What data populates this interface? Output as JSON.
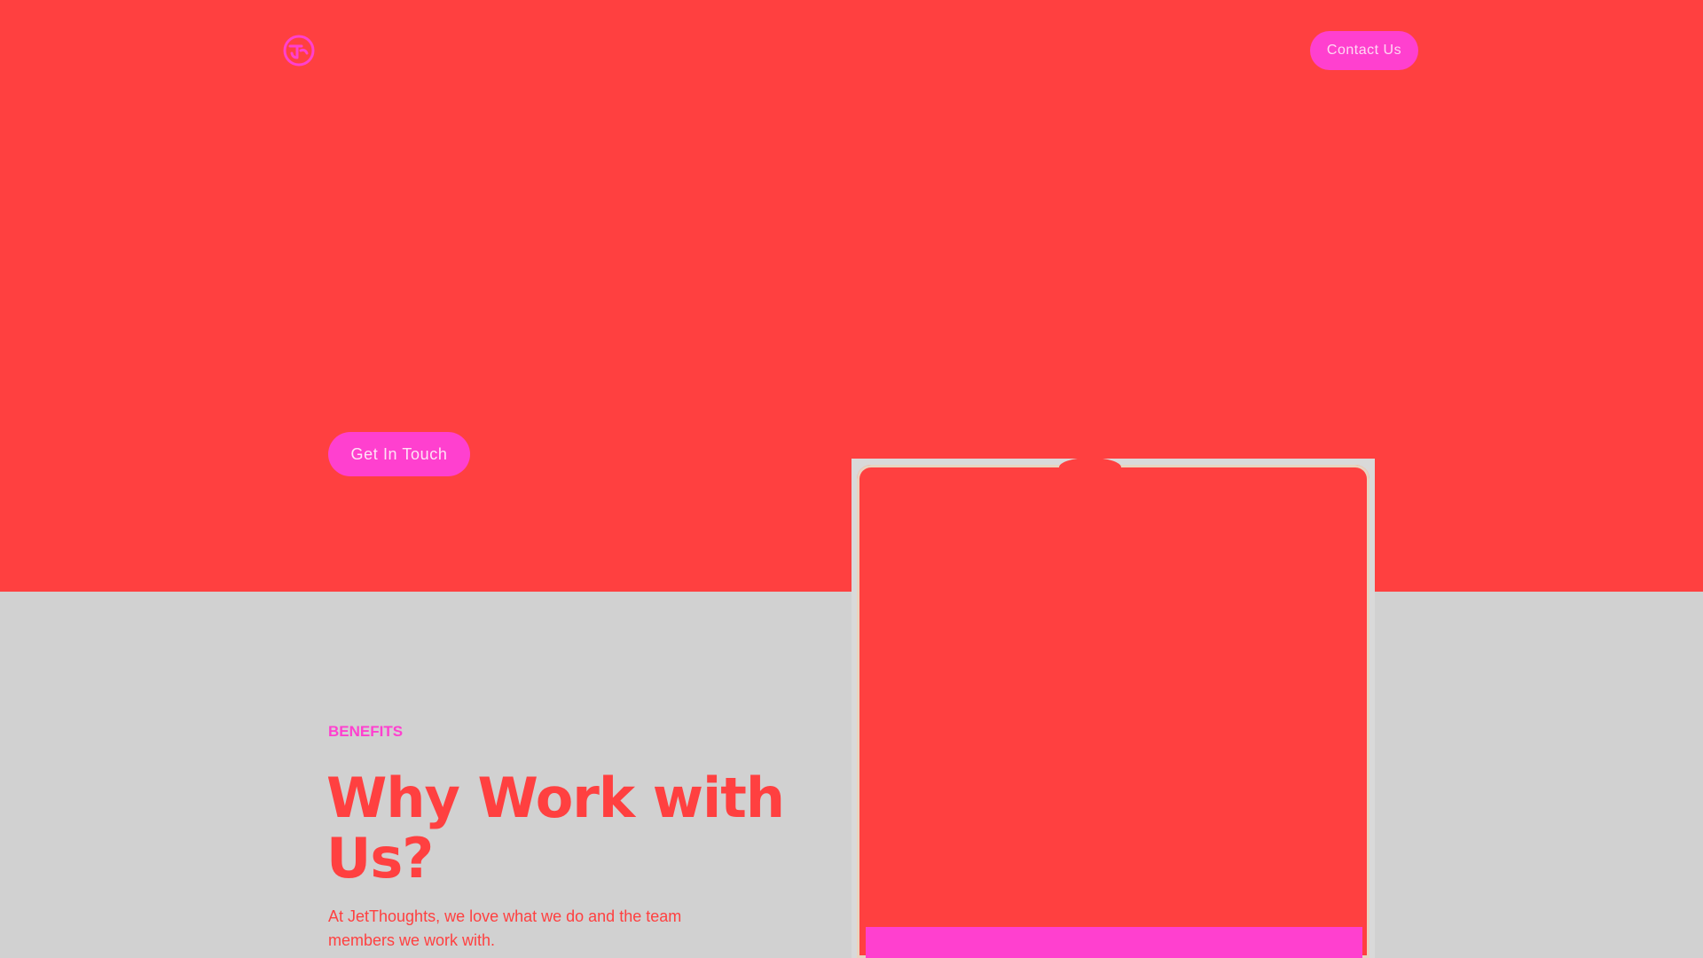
{
  "header": {
    "logo_icon": "jetthoughts-logo-icon",
    "contact_button_label": "Contact Us"
  },
  "hero": {
    "cta_label": "Get In Touch"
  },
  "benefits": {
    "eyebrow": "BENEFITS",
    "heading": "Why Work with Us?",
    "intro": "At JetThoughts, we love what we do and the team members we work with."
  },
  "colors": {
    "hero_background": "#ff4040",
    "accent": "#ff40cf",
    "section_background": "#d1d1d1"
  }
}
